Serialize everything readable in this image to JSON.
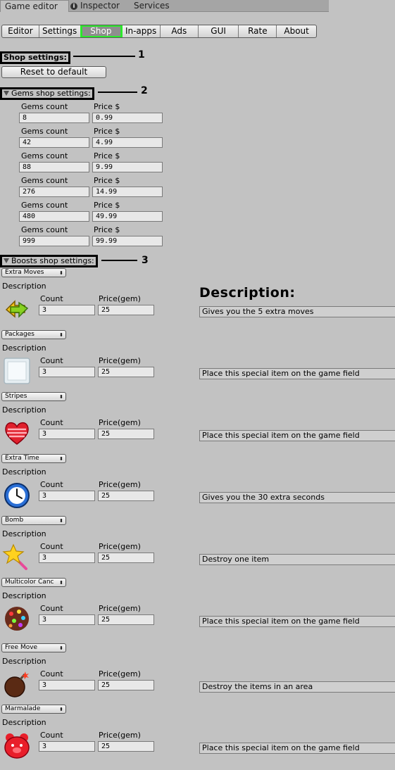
{
  "window_tabs": [
    {
      "label": "Game editor"
    },
    {
      "label": "Inspector"
    },
    {
      "label": "Services"
    }
  ],
  "toolbar": [
    "Editor",
    "Settings",
    "Shop",
    "In-apps",
    "Ads",
    "GUI",
    "Rate",
    "About"
  ],
  "toolbar_active": "Shop",
  "accent_color": "#2ce82c",
  "shop": {
    "title": "Shop settings:",
    "reset_label": "Reset to default",
    "callouts": [
      "1",
      "2",
      "3"
    ]
  },
  "gems": {
    "title": "Gems shop settings:",
    "count_label": "Gems count",
    "price_label": "Price $",
    "rows": [
      {
        "count": "8",
        "price": "0.99"
      },
      {
        "count": "42",
        "price": "4.99"
      },
      {
        "count": "88",
        "price": "9.99"
      },
      {
        "count": "276",
        "price": "14.99"
      },
      {
        "count": "480",
        "price": "49.99"
      },
      {
        "count": "999",
        "price": "99.99"
      }
    ]
  },
  "boosts": {
    "title": "Boosts shop settings:",
    "description_heading": "Description:",
    "description_label": "Description",
    "count_label": "Count",
    "price_label": "Price(gem)",
    "items": [
      {
        "name": "Extra Moves",
        "count": "3",
        "price": "25",
        "description": "Gives you the 5 extra moves",
        "icon": "extra-moves-arrows-icon"
      },
      {
        "name": "Packages",
        "count": "3",
        "price": "25",
        "description": "Place this special item on the game field",
        "icon": "package-icon"
      },
      {
        "name": "Stripes",
        "count": "3",
        "price": "25",
        "description": "Place this special item on the game field",
        "icon": "striped-heart-icon"
      },
      {
        "name": "Extra Time",
        "count": "3",
        "price": "25",
        "description": "Gives you the 30 extra seconds",
        "icon": "clock-icon"
      },
      {
        "name": "Bomb",
        "count": "3",
        "price": "25",
        "description": "Destroy one item",
        "icon": "star-wand-icon"
      },
      {
        "name": "Multicolor Canc",
        "count": "3",
        "price": "25",
        "description": "Place this special item on the game field",
        "icon": "multicolor-candy-icon"
      },
      {
        "name": "Free Move",
        "count": "3",
        "price": "25",
        "description": "Destroy the items in an area",
        "icon": "bomb-icon"
      },
      {
        "name": "Marmalade",
        "count": "3",
        "price": "25",
        "description": "Place this special item on the game field",
        "icon": "marmalade-bear-icon"
      }
    ]
  }
}
